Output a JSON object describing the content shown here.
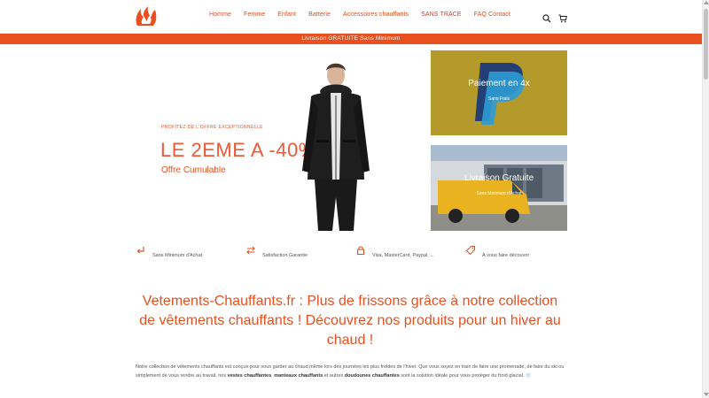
{
  "header": {
    "nav": [
      {
        "label": "Homme"
      },
      {
        "label": "Femme"
      },
      {
        "label": "Enfant"
      },
      {
        "label": "Batterie"
      },
      {
        "label": "Accessoires chauffants"
      },
      {
        "label": "SANS TRACE"
      },
      {
        "label": "FAQ Contact"
      }
    ],
    "icons": [
      "search-icon",
      "cart-icon"
    ]
  },
  "promo": {
    "text": "Livraison GRATUITE Sans Minimum"
  },
  "hero": {
    "kicker": "Profitez de l'offre exceptionnelle",
    "title": "LE 2EME A -40%",
    "subtitle": "Offre Cumulable"
  },
  "cards": {
    "payment": {
      "title": "Paiement en 4x",
      "subtitle": "Sans Frais"
    },
    "shipping": {
      "title": "Livraison Gratuite",
      "subtitle": "Sans Minimum d'Achat"
    }
  },
  "features": [
    {
      "icon": "return-arrow-icon",
      "text": "Sans Minimum d'Achat"
    },
    {
      "icon": "exchange-icon",
      "text": "Satisfaction Garantie"
    },
    {
      "icon": "lock-icon",
      "text": "Visa, MasterCard, Paypal, ..."
    },
    {
      "icon": "tag-icon",
      "text": "À vous faire découvrir"
    }
  ],
  "main": {
    "heading": "Vetements-Chauffants.fr : Plus de frissons grâce à notre collection de vêtements chauffants ! Découvrez nos produits pour un hiver au chaud !",
    "body_1": "Notre collection de vêtements chauffants est conçue pour vous garder au chaud même lors des journées les plus froides de l'hiver. Que vous soyez en train de faire une promenade, de faire du ski ou simplement de vous rendre au travail, nos ",
    "body_bold_1": "vestes chauffantes",
    "body_2": ", ",
    "body_bold_2": "manteaux chauffants",
    "body_3": " et autres ",
    "body_bold_3": "doudounes chauffantes",
    "body_4": " sont la solution idéale pour vous protéger du froid glacial. ❄️"
  },
  "colors": {
    "accent": "#e8501f",
    "payment_card": "#b39a2b"
  }
}
